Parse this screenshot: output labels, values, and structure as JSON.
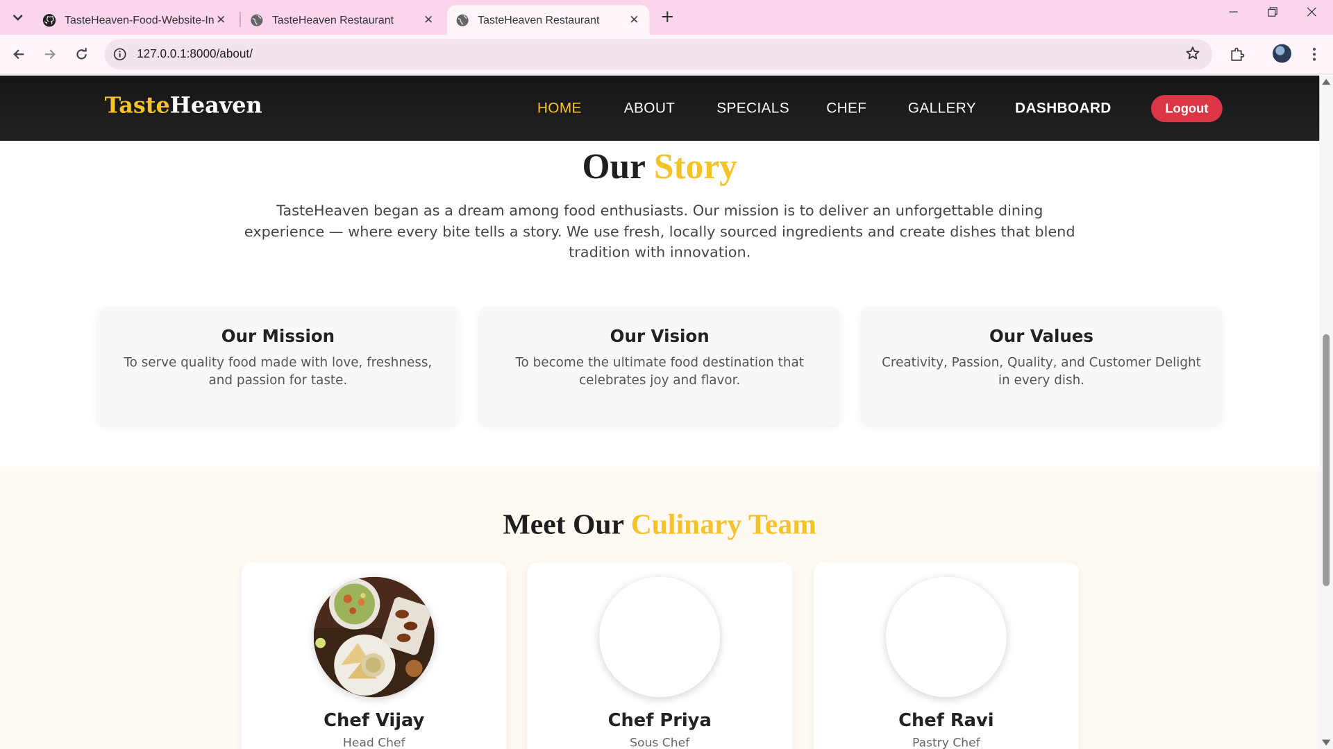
{
  "browser": {
    "tabs": [
      {
        "title": "TasteHeaven-Food-Website-In-Dj",
        "icon": "github-icon"
      },
      {
        "title": "TasteHeaven Restaurant",
        "icon": "globe-icon"
      },
      {
        "title": "TasteHeaven Restaurant",
        "icon": "globe-icon",
        "active": true
      }
    ],
    "new_tab": "+",
    "url": "127.0.0.1:8000/about/"
  },
  "nav": {
    "logo_part1": "Taste",
    "logo_part2": "Heaven",
    "links": [
      "HOME",
      "ABOUT",
      "SPECIALS",
      "CHEF",
      "GALLERY",
      "DASHBOARD"
    ],
    "logout": "Logout"
  },
  "story": {
    "title_part1": "Our",
    "title_part2": "Story",
    "text": "TasteHeaven began as a dream among food enthusiasts. Our mission is to deliver an unforgettable dining experience — where every bite tells a story. We use fresh, locally sourced ingredients and create dishes that blend tradition with innovation."
  },
  "cards": [
    {
      "title": "Our Mission",
      "text": "To serve quality food made with love, freshness, and passion for taste."
    },
    {
      "title": "Our Vision",
      "text": "To become the ultimate food destination that celebrates joy and flavor."
    },
    {
      "title": "Our Values",
      "text": "Creativity, Passion, Quality, and Customer Delight in every dish."
    }
  ],
  "team": {
    "title_part1": "Meet Our",
    "title_part2": "Culinary Team",
    "chefs": [
      {
        "name": "Chef Vijay",
        "role": "Head Chef"
      },
      {
        "name": "Chef Priya",
        "role": "Sous Chef"
      },
      {
        "name": "Chef Ravi",
        "role": "Pastry Chef"
      }
    ]
  },
  "colors": {
    "accent": "#f5c22a",
    "logout": "#dc3545",
    "nav_bg": "#1a1a1a",
    "tab_strip": "#fbd5ec"
  }
}
